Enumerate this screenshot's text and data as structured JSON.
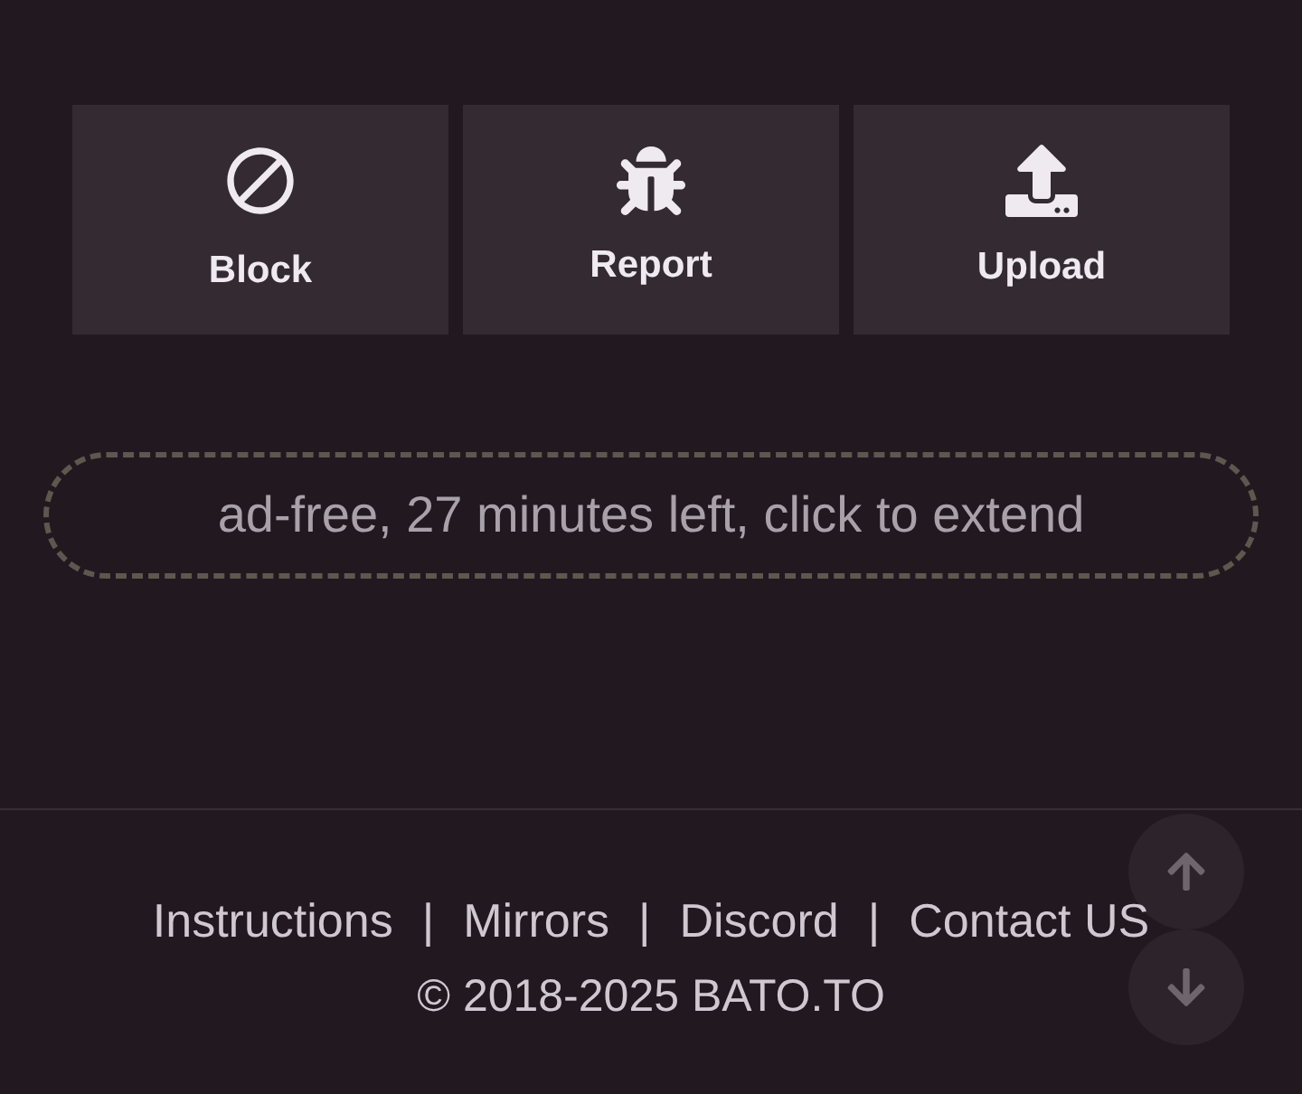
{
  "actions": [
    {
      "kind": "block",
      "label": "Block"
    },
    {
      "kind": "bug",
      "label": "Report"
    },
    {
      "kind": "upload",
      "label": "Upload"
    }
  ],
  "ad_free_notice": "ad-free, 27 minutes left, click to extend",
  "footer": {
    "links": [
      "Instructions",
      "Mirrors",
      "Discord",
      "Contact US"
    ],
    "separator": "|",
    "copyright": "© 2018-2025 BATO.TO"
  }
}
